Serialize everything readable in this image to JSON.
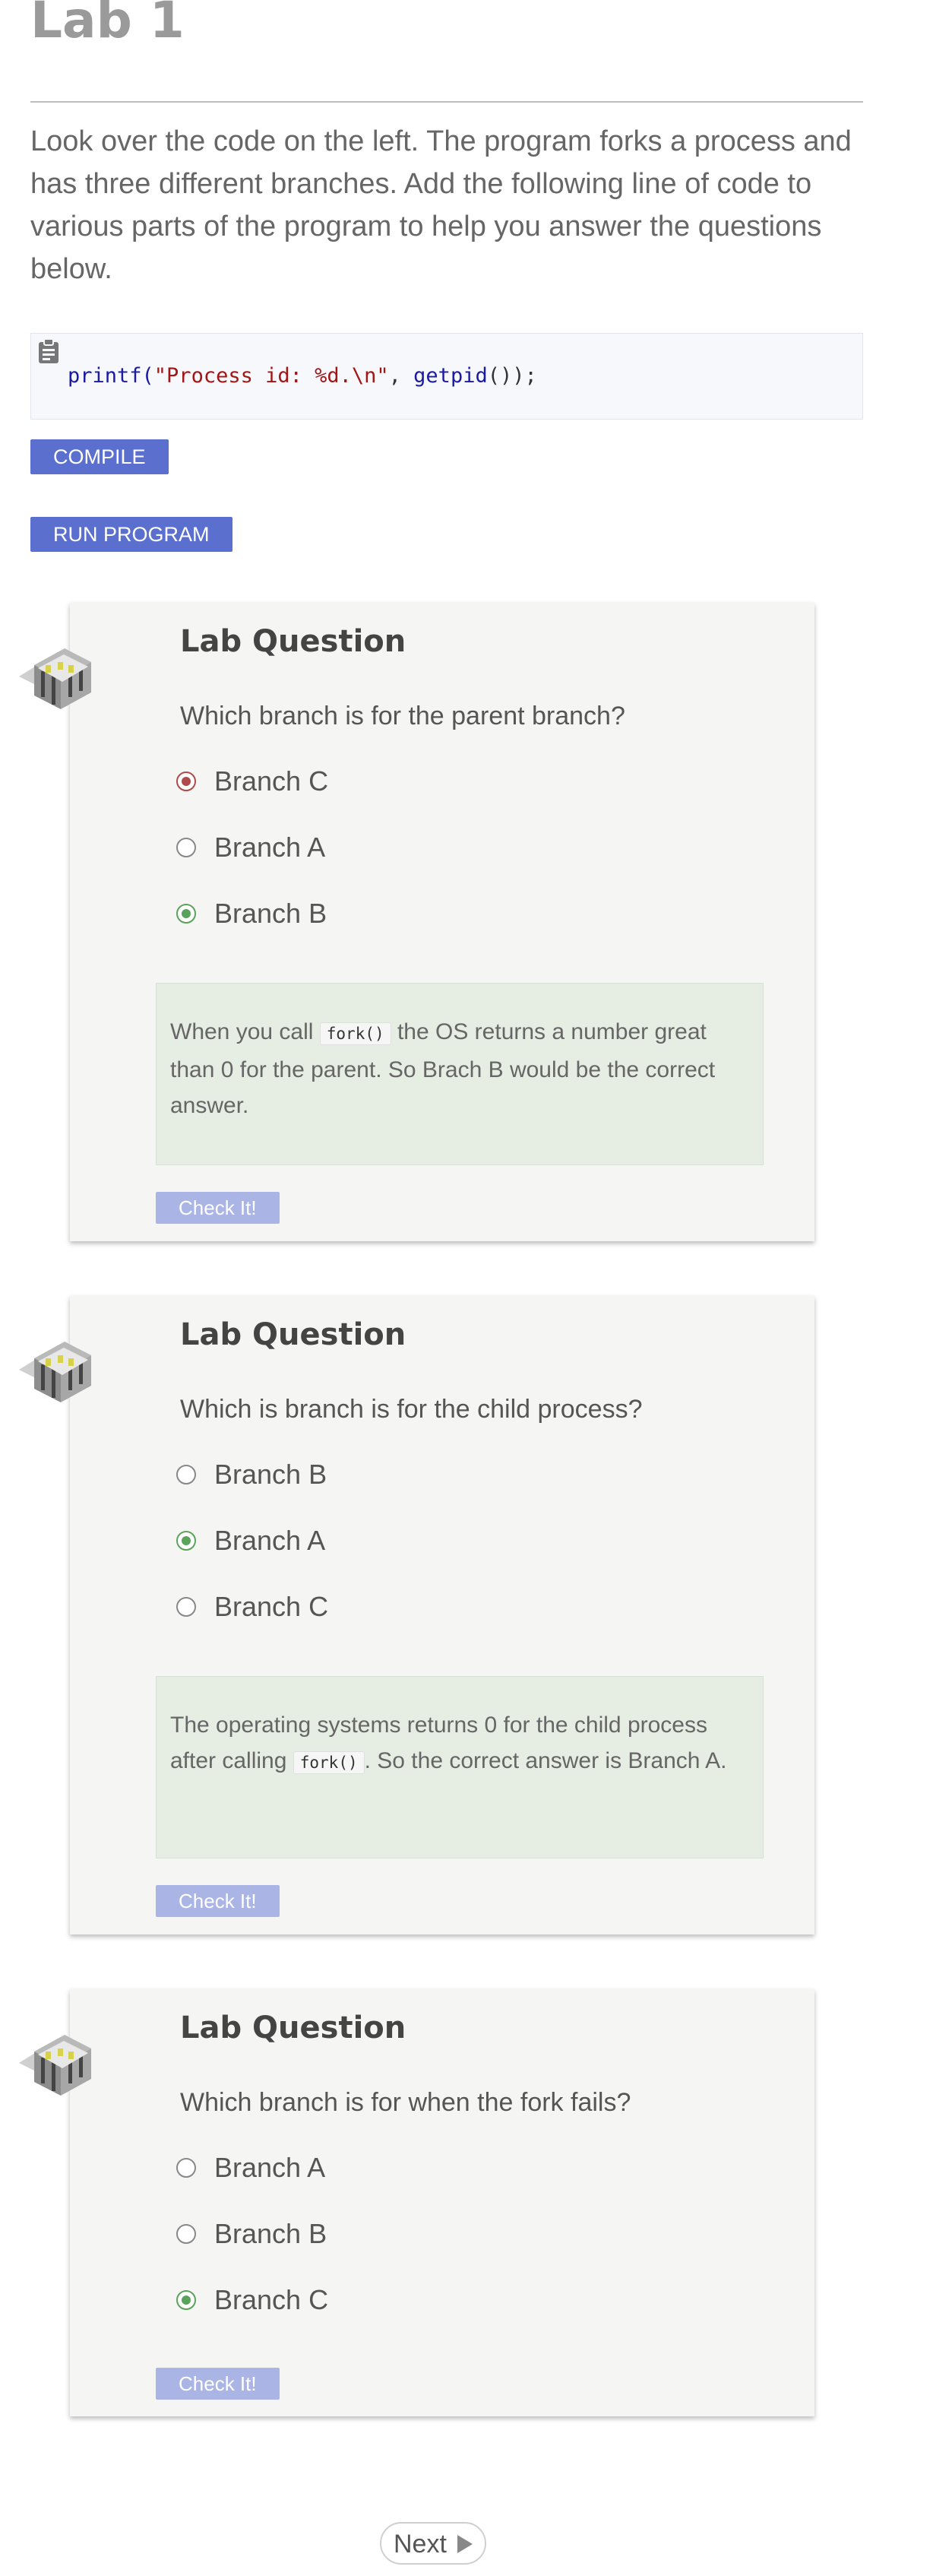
{
  "lab": {
    "title": "Lab 1",
    "intro": "Look over the code on the left. The program forks a process and has three different branches. Add the following line of code to various parts of the program to help you answer the questions below.",
    "code": {
      "fn": "printf(",
      "str": "\"Process id: %d.\\n\"",
      "mid": ", ",
      "call": "getpid",
      "end": "());"
    },
    "compile_label": "COMPILE",
    "run_label": "RUN PROGRAM"
  },
  "questions": [
    {
      "heading": "Lab Question",
      "text": "Which branch is for the parent branch?",
      "options": [
        {
          "label": "Branch C",
          "state": "wrong"
        },
        {
          "label": "Branch A",
          "state": "none"
        },
        {
          "label": "Branch B",
          "state": "correct"
        }
      ],
      "feedback_before": "When you call ",
      "feedback_code": "fork()",
      "feedback_after": " the OS returns a number great than 0 for the parent. So Brach B would be the correct answer.",
      "check_label": "Check It!"
    },
    {
      "heading": "Lab Question",
      "text": "Which is branch is for the child process?",
      "options": [
        {
          "label": "Branch B",
          "state": "none"
        },
        {
          "label": "Branch A",
          "state": "correct"
        },
        {
          "label": "Branch C",
          "state": "none"
        }
      ],
      "feedback_before": "The operating systems returns 0 for the child process after calling ",
      "feedback_code": "fork()",
      "feedback_after": ". So the correct answer is Branch A.",
      "check_label": "Check It!"
    },
    {
      "heading": "Lab Question",
      "text": "Which branch is for when the fork fails?",
      "options": [
        {
          "label": "Branch A",
          "state": "none"
        },
        {
          "label": "Branch B",
          "state": "none"
        },
        {
          "label": "Branch C",
          "state": "correct"
        }
      ],
      "check_label": "Check It!"
    }
  ],
  "nav": {
    "next_label": "Next"
  },
  "colors": {
    "accent": "#5b6fcf",
    "correct": "#5aa35a",
    "wrong": "#b04a4a",
    "feedback_bg": "#e6ede3"
  },
  "icons": {
    "card": "lab-bench-icon",
    "clipboard": "clipboard-icon",
    "next": "play-arrow-icon"
  }
}
